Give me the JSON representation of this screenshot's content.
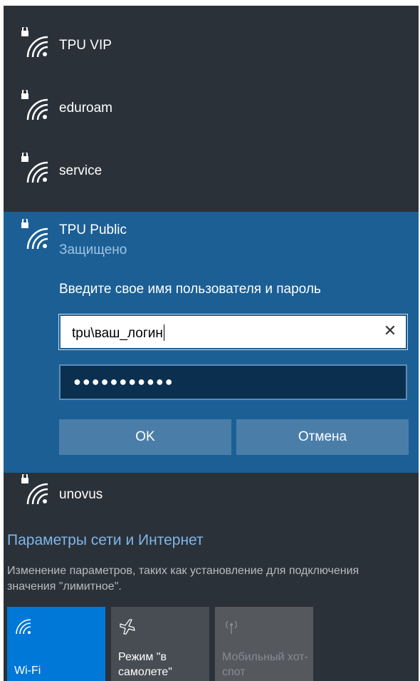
{
  "networks": {
    "items": [
      {
        "name": "TPU VIP"
      },
      {
        "name": "eduroam"
      },
      {
        "name": "service"
      }
    ],
    "expanded": {
      "name": "TPU Public",
      "status": "Защищено",
      "prompt": "Введите свое имя пользователя и пароль",
      "username_value": "tpu\\ваш_логин",
      "password_dots": "●●●●●●●●●●●",
      "ok_label": "OK",
      "cancel_label": "Отмена"
    },
    "after": [
      {
        "name": "unovus"
      }
    ]
  },
  "settings": {
    "title": "Параметры сети и Интернет",
    "description": "Изменение параметров, таких как установление для подключения значения \"лимитное\"."
  },
  "quick_actions": {
    "wifi": {
      "label": "Wi-Fi",
      "icon": "wifi-icon",
      "state": "on"
    },
    "airplane": {
      "label": "Режим \"в самолете\"",
      "icon": "airplane-icon",
      "state": "off"
    },
    "hotspot": {
      "label": "Мобильный хот-спот",
      "icon": "hotspot-icon",
      "state": "disabled"
    }
  },
  "colors": {
    "panel_bg": "#2b3139",
    "expanded_bg": "#1b5f95",
    "accent": "#0078d7",
    "link": "#7fb6e8"
  }
}
